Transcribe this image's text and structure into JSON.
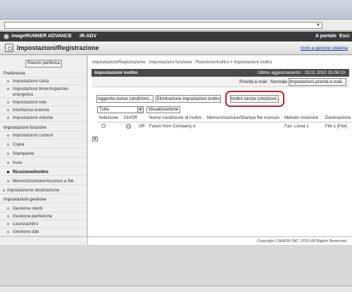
{
  "header": {
    "brand": "imageRUNNER ADVANCE",
    "model": "iR-ADV",
    "portal_link": "A portale",
    "exit_link": "Esci"
  },
  "title_bar": {
    "title": "Impostazioni/Registrazione",
    "send_admin": "Invio a gestore sistema"
  },
  "sidebar": {
    "restart_button": "Riavvio periferica",
    "items": [
      {
        "label": "Preferenze"
      },
      {
        "label": "Impostazioni carta"
      },
      {
        "label": "Impostazioni timer/risparmio energetico"
      },
      {
        "label": "Impostazioni rete"
      },
      {
        "label": "Interfaccia esterna"
      },
      {
        "label": "Impostazioni volume"
      },
      {
        "label": "Impostazioni funzione"
      },
      {
        "label": "Impostazioni comuni"
      },
      {
        "label": "Copia"
      },
      {
        "label": "Stampante"
      },
      {
        "label": "Invio"
      },
      {
        "label": "Ricezione/Inoltro"
      },
      {
        "label": "Memorizzazione/Accesso a file"
      },
      {
        "label": "Impostazione destinazione"
      },
      {
        "label": "Impostazioni gestione"
      },
      {
        "label": "Gestione utenti"
      },
      {
        "label": "Gestione periferiche"
      },
      {
        "label": "Licenza/Altro"
      },
      {
        "label": "Gestione dati"
      }
    ]
  },
  "main": {
    "breadcrumb": "Impostazioni/Registrazione : Impostazioni funzione : Ricezione/Inoltro > Impostazioni inoltro",
    "section_title": "Impostazioni inoltro",
    "last_update": "Ultimo aggiornamento : 22/11 2010 15:06:10",
    "priority_text": "Priorità e-mail : Normale",
    "priority_button": "Impostazioni priorità e-mail...",
    "add_button": "Aggiunta nuove condizioni...",
    "delete_button": "Eliminazione impostazioni inoltro",
    "unconditional_button": "Inoltro senza condizioni...",
    "filter_value": "Tutte",
    "view_button": "Visualizzazione",
    "columns": {
      "selection": "Selezione",
      "onoff": "On/Off",
      "name": "Nome condizione di inoltro",
      "store": "Memorizzazione/Stampa file ricevuto",
      "method": "Metodo ricezione",
      "destination": "Destinazione"
    },
    "row": {
      "state": "Off",
      "name": "Faxes from Company A",
      "method": "Fax: Linea 1",
      "destination": "File 1 [File]"
    }
  },
  "footer": {
    "copyright": "Copyright CANON INC. 2010 All Rights Reserved."
  },
  "colors": {
    "header_bg": "#3a3a3a",
    "highlight": "#c8202a",
    "link": "#0a3a8a"
  }
}
